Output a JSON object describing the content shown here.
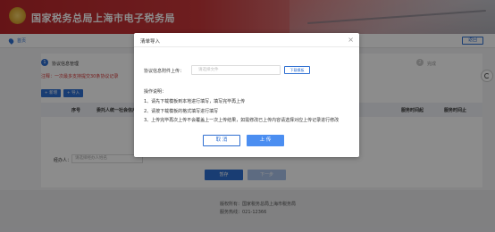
{
  "header": {
    "title": "国家税务总局上海市电子税务局"
  },
  "breadcrumb": {
    "home": "首页"
  },
  "toolbar": {
    "back_label": "返回"
  },
  "steps": [
    {
      "index": "1",
      "label": "协议信息管理"
    },
    {
      "index": "2",
      "label": "完成"
    }
  ],
  "notice": "注释：一次最多支持提交30条协议记录",
  "table_buttons": {
    "add": "+ 新增",
    "import": "+ 导入"
  },
  "table": {
    "columns": [
      "序号",
      "委托人统一社会信用代码",
      "服务时间起",
      "服务时间止"
    ]
  },
  "handler": {
    "label": "经办人：",
    "placeholder": "请选择经办人姓名"
  },
  "nav": {
    "prev": "暂存",
    "next": "下一步"
  },
  "footer": {
    "line1": "版权所有：国家税务总局上海市税务局",
    "line2": "服务热线：021-12366"
  },
  "modal": {
    "title": "清单导入",
    "close": "×",
    "upload_label": "协议信息附件上传：",
    "upload_placeholder": "请选择文件",
    "download_label": "下载模板",
    "ops_title": "操作说明：",
    "ops": [
      "1、请先下载模板到本地进行填写，填写完毕再上传",
      "2、请按下载模板的格式填写进行填写",
      "3、上传完毕再次上传不会覆盖上一次上传结果，如需修改已上传内容请选择对应上传记录进行修改"
    ],
    "cancel": "取 消",
    "upload": "上 传"
  },
  "colors": {
    "accent": "#2f6fd1",
    "header_red": "#b9262a",
    "notice_red": "#d83b3b"
  }
}
